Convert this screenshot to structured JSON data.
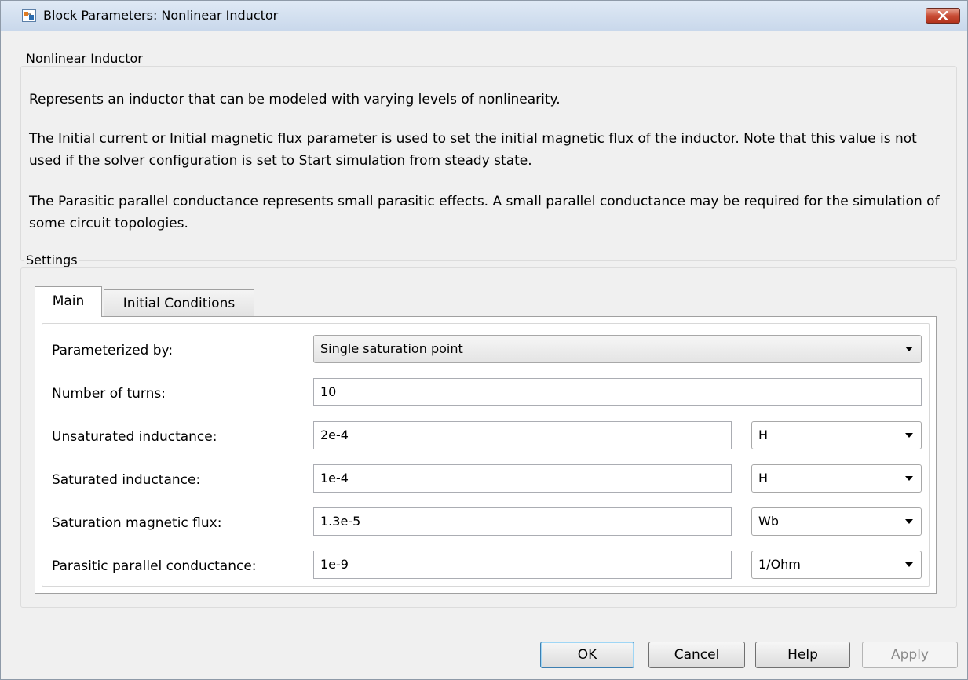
{
  "window": {
    "title": "Block Parameters: Nonlinear Inductor",
    "icon": "simulink-block-icon",
    "close_icon": "close-icon"
  },
  "description": {
    "group_label": "Nonlinear Inductor",
    "paragraphs": [
      "Represents an inductor that can be modeled with varying levels of nonlinearity.",
      "The Initial current or Initial magnetic flux parameter is used to set the initial magnetic flux of the inductor. Note that this value is not used if the solver configuration is set to Start simulation from steady state.",
      "The Parasitic parallel conductance represents small parasitic effects. A small parallel conductance may be required for the simulation of some circuit topologies."
    ]
  },
  "settings": {
    "group_label": "Settings",
    "tabs": [
      {
        "label": "Main",
        "active": true
      },
      {
        "label": "Initial Conditions",
        "active": false
      }
    ],
    "params": {
      "parameterized_by": {
        "label": "Parameterized by:",
        "value": "Single saturation point"
      },
      "turns": {
        "label": "Number of turns:",
        "value": "10"
      },
      "unsat_ind": {
        "label": "Unsaturated inductance:",
        "value": "2e-4",
        "unit": "H"
      },
      "sat_ind": {
        "label": "Saturated inductance:",
        "value": "1e-4",
        "unit": "H"
      },
      "sat_flux": {
        "label": "Saturation magnetic flux:",
        "value": "1.3e-5",
        "unit": "Wb"
      },
      "parasitic": {
        "label": "Parasitic parallel conductance:",
        "value": "1e-9",
        "unit": "1/Ohm"
      }
    }
  },
  "buttons": {
    "ok": "OK",
    "cancel": "Cancel",
    "help": "Help",
    "apply": "Apply"
  },
  "colors": {
    "close_button": "#c94d36",
    "default_button_border": "#3c7fb1"
  }
}
